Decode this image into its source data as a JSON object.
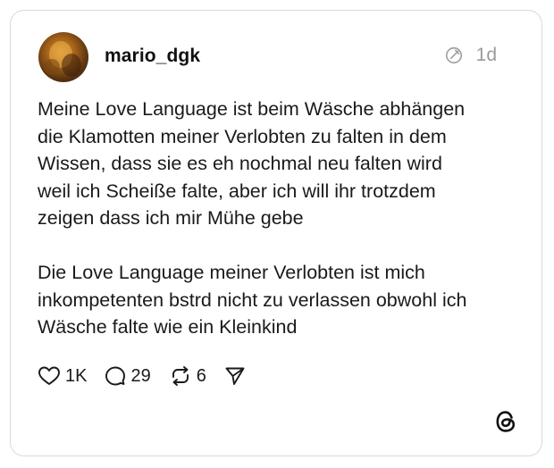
{
  "post": {
    "username": "mario_dgk",
    "timestamp": "1d",
    "text": "Meine Love Language ist beim Wäsche abhängen\ndie Klamotten meiner Verlobten zu falten in dem\nWissen, dass sie es eh nochmal neu falten wird\nweil ich Scheiße falte, aber ich will ihr trotzdem\nzeigen dass ich mir Mühe gebe\n\nDie Love Language meiner Verlobten ist mich\ninkompetenten bstrd nicht zu verlassen obwohl ich\nWäsche falte wie ein Kleinkind"
  },
  "actions": {
    "likes": "1K",
    "replies": "29",
    "reposts": "6"
  },
  "icons": {
    "like": "heart-icon",
    "reply": "comment-icon",
    "repost": "repost-icon",
    "share": "send-icon",
    "edited": "edited-badge-icon",
    "brand": "threads-logo-icon"
  },
  "colors": {
    "text": "#1a1a1a",
    "muted": "#9a9a9a",
    "border": "#d9d9d9"
  }
}
